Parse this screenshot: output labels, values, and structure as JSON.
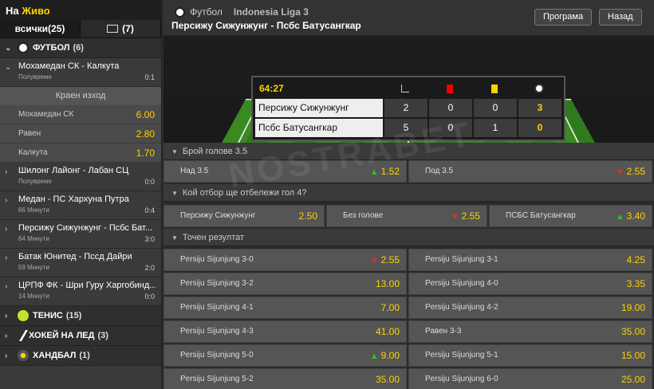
{
  "sidebar": {
    "header_prefix": "На",
    "header_live": "Живо",
    "tab_all": "всички(25)",
    "tab_tv": "(7)",
    "football": {
      "label": "ФУТБОЛ",
      "count": "(6)"
    },
    "matches": [
      {
        "name": "Мохамедан СК - Калкута",
        "status": "Полувреме",
        "score": "0:1"
      },
      {
        "name": "Шилонг Лайонг - Лабан СЦ",
        "status": "Полувреме",
        "score": "0:0"
      },
      {
        "name": "Медан - ПС Хархуна Путра",
        "status": "66 Минути",
        "score": "0:4"
      },
      {
        "name": "Персижу Сижунжунг - Псбс Бат...",
        "status": "64 Минути",
        "score": "3:0"
      },
      {
        "name": "Батак Юнитед - Пссд Дайри",
        "status": "59 Минути",
        "score": "2:0"
      },
      {
        "name": "ЦРПФ ФК - Шри Гуру Харгобинд...",
        "status": "14 Минути",
        "score": "0:0"
      }
    ],
    "market": {
      "title": "Краен изход",
      "rows": [
        {
          "label": "Мохамедан СК",
          "odd": "6.00"
        },
        {
          "label": "Равен",
          "odd": "2.80"
        },
        {
          "label": "Калкута",
          "odd": "1.70"
        }
      ]
    },
    "tennis": {
      "label": "ТЕНИС",
      "count": "(15)"
    },
    "hockey": {
      "label": "ХОКЕЙ НА ЛЕД",
      "count": "(3)"
    },
    "handball": {
      "label": "ХАНДБАЛ",
      "count": "(1)"
    }
  },
  "header": {
    "sport": "Футбол",
    "league": "Indonesia Liga 3",
    "title": "Персижу Сижунжунг - Псбс Батусангкар",
    "btn_program": "Програма",
    "btn_back": "Назад"
  },
  "scoreboard": {
    "time": "64:27",
    "rows": [
      {
        "team": "Персижу Сижунжунг",
        "corners": "2",
        "red": "0",
        "yellow": "0",
        "goals": "3"
      },
      {
        "team": "Псбс Батусангкар",
        "corners": "5",
        "red": "0",
        "yellow": "1",
        "goals": "0"
      }
    ]
  },
  "watermark": "NOSTRABET",
  "markets": {
    "goals": {
      "title": "Брой голове 3.5",
      "over_label": "Над 3.5",
      "over_val": "1.52",
      "under_label": "Под 3.5",
      "under_val": "2.55"
    },
    "next": {
      "title": "Кой отбор ще отбележи гол 4?",
      "home_label": "Персижу Сижунжунг",
      "home_val": "2.50",
      "none_label": "Без голове",
      "none_val": "2.55",
      "away_label": "ПСБС Батусангкар",
      "away_val": "3.40"
    },
    "correct": {
      "title": "Точен резултат",
      "rows": [
        [
          {
            "label": "Persiju Sijunjung 3-0",
            "val": "2.55",
            "dir": "down"
          },
          {
            "label": "Persiju Sijunjung 3-1",
            "val": "4.25",
            "dir": ""
          }
        ],
        [
          {
            "label": "Persiju Sijunjung 3-2",
            "val": "13.00",
            "dir": ""
          },
          {
            "label": "Persiju Sijunjung 4-0",
            "val": "3.35",
            "dir": ""
          }
        ],
        [
          {
            "label": "Persiju Sijunjung 4-1",
            "val": "7.00",
            "dir": ""
          },
          {
            "label": "Persiju Sijunjung 4-2",
            "val": "19.00",
            "dir": ""
          }
        ],
        [
          {
            "label": "Persiju Sijunjung 4-3",
            "val": "41.00",
            "dir": ""
          },
          {
            "label": "Равен 3-3",
            "val": "35.00",
            "dir": ""
          }
        ],
        [
          {
            "label": "Persiju Sijunjung 5-0",
            "val": "9.00",
            "dir": "up"
          },
          {
            "label": "Persiju Sijunjung 5-1",
            "val": "15.00",
            "dir": ""
          }
        ],
        [
          {
            "label": "Persiju Sijunjung 5-2",
            "val": "35.00",
            "dir": ""
          },
          {
            "label": "Persiju Sijunjung 6-0",
            "val": "25.00",
            "dir": ""
          }
        ]
      ]
    }
  }
}
